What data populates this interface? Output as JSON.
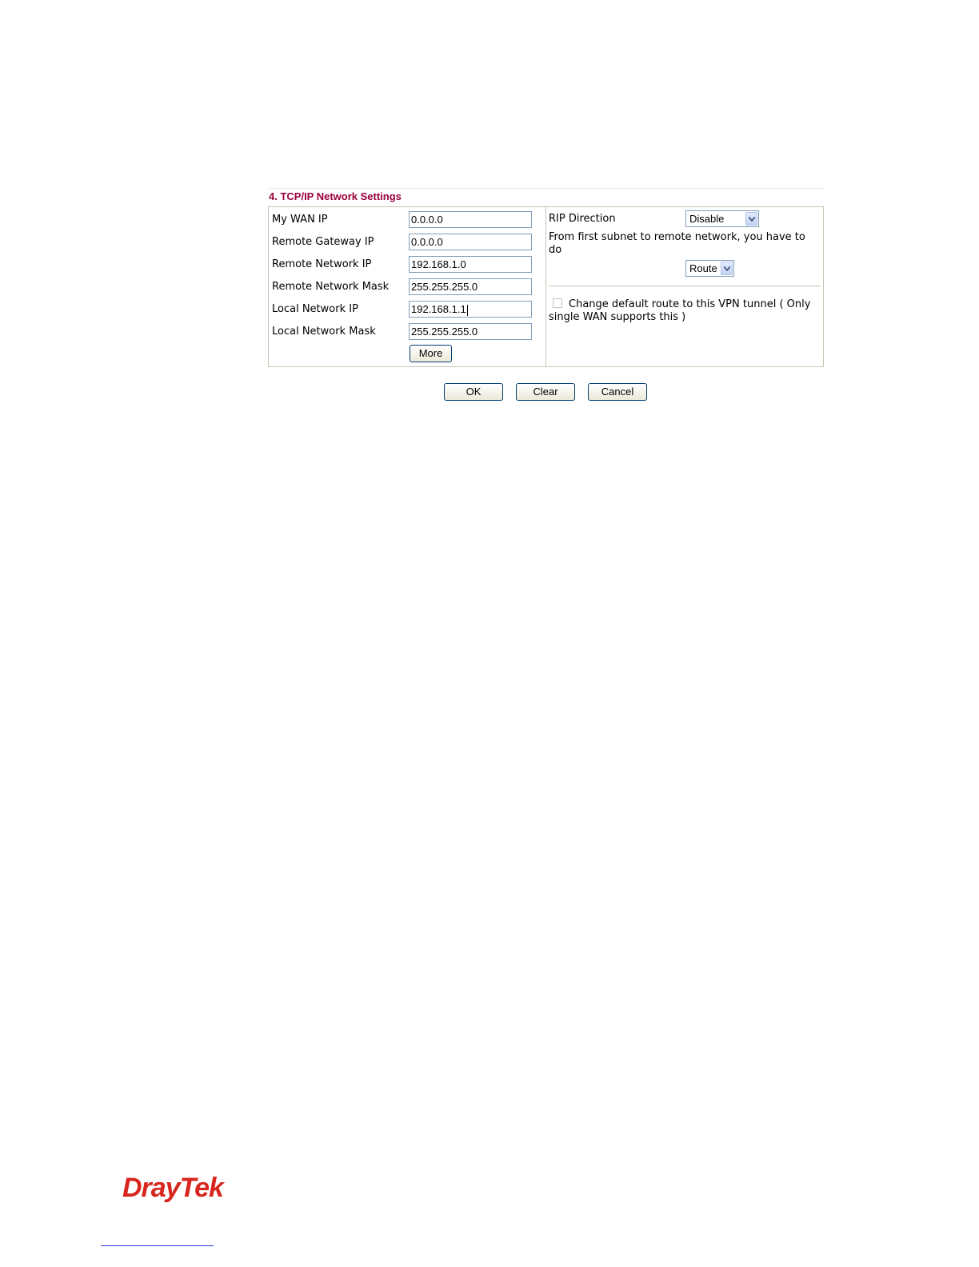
{
  "section": {
    "title": "4. TCP/IP Network Settings"
  },
  "left_fields": [
    {
      "label": "My WAN IP",
      "value": "0.0.0.0"
    },
    {
      "label": "Remote Gateway IP",
      "value": "0.0.0.0"
    },
    {
      "label": "Remote Network IP",
      "value": "192.168.1.0"
    },
    {
      "label": "Remote Network Mask",
      "value": "255.255.255.0"
    },
    {
      "label": "Local Network IP",
      "value": "192.168.1.1"
    },
    {
      "label": "Local Network Mask",
      "value": "255.255.255.0"
    }
  ],
  "more_label": "More",
  "right": {
    "rip_label": "RIP Direction",
    "rip_value": "Disable",
    "subnet_text": "From first subnet to remote network, you have to do",
    "route_value": "Route",
    "default_route_text": "Change default route to this VPN tunnel ( Only single WAN supports this )"
  },
  "actions": {
    "ok": "OK",
    "clear": "Clear",
    "cancel": "Cancel"
  },
  "footer": {
    "brand": "DrayTek"
  },
  "colors": {
    "title": "#99003a",
    "brand": "#d7261e",
    "border": "#c4c4b4",
    "field_border": "#7f9db9"
  }
}
